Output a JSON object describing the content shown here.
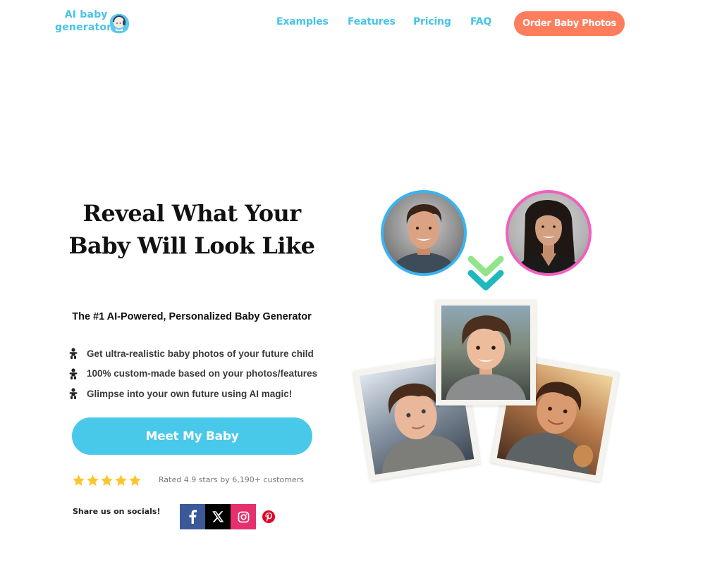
{
  "header": {
    "logo": {
      "line1": "AI baby",
      "line2": "generator",
      "icon": "baby-headphones-icon"
    },
    "nav": [
      {
        "label": "Examples"
      },
      {
        "label": "Features"
      },
      {
        "label": "Pricing"
      },
      {
        "label": "FAQ"
      }
    ],
    "order_button": "Order Baby Photos"
  },
  "hero": {
    "title": "Reveal What Your Baby Will Look Like",
    "subtitle": "The #1 AI-Powered, Personalized Baby Generator",
    "features": [
      {
        "text": "Get ultra-realistic baby photos of your future child",
        "icon": "baby-icon"
      },
      {
        "text": "100% custom-made based on your photos/features",
        "icon": "baby-icon"
      },
      {
        "text": "Glimpse into your own future using AI magic!",
        "icon": "baby-icon"
      }
    ],
    "cta": "Meet My Baby",
    "rating": {
      "stars": 5,
      "value": 4.9,
      "text": "Rated 4.9 stars by 6,190+ customers"
    },
    "share": {
      "label": "Share us on socials!",
      "networks": [
        {
          "name": "facebook",
          "icon": "facebook-icon",
          "color": "#3b5998"
        },
        {
          "name": "x",
          "icon": "x-icon",
          "color": "#000000"
        },
        {
          "name": "instagram",
          "icon": "instagram-icon",
          "color": "#e4306c"
        },
        {
          "name": "pinterest",
          "icon": "pinterest-icon",
          "color": "#e60023"
        }
      ]
    }
  },
  "visual": {
    "parents": [
      {
        "role": "father",
        "ring_color": "#3ab3f0"
      },
      {
        "role": "mother",
        "ring_color": "#f25fbe"
      }
    ],
    "arrow_colors": [
      "#93e58a",
      "#1fb9bd"
    ],
    "children_photos": 3
  },
  "colors": {
    "brand": "#46c4e8",
    "accent": "#fd7d5d",
    "cta": "#48c9e9",
    "star": "#fbc52e"
  }
}
